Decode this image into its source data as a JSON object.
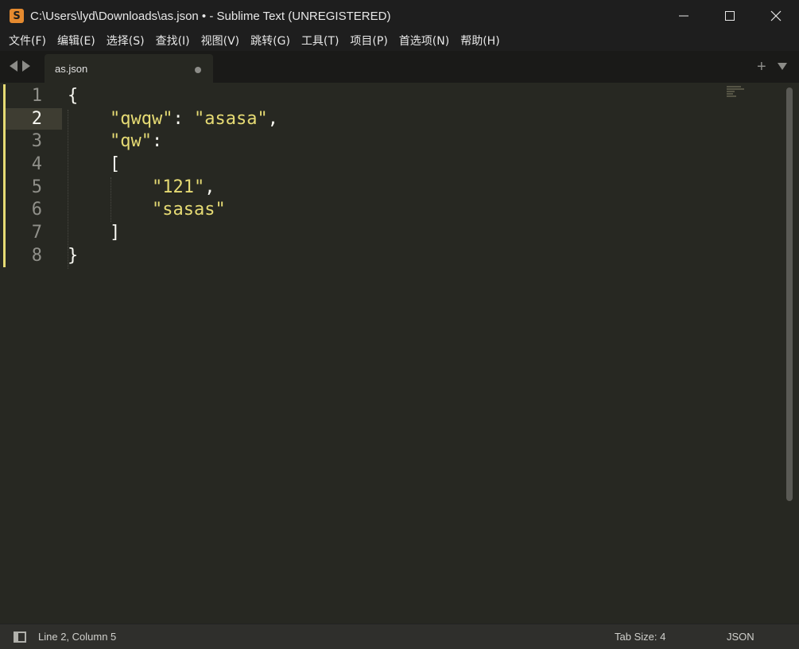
{
  "window": {
    "title": "C:\\Users\\lyd\\Downloads\\as.json • - Sublime Text (UNREGISTERED)",
    "app_icon": "sublime-text-icon",
    "controls": [
      "minimize-icon",
      "maximize-icon",
      "close-icon"
    ]
  },
  "menu": {
    "items": [
      "文件(F)",
      "编辑(E)",
      "选择(S)",
      "查找(I)",
      "视图(V)",
      "跳转(G)",
      "工具(T)",
      "项目(P)",
      "首选项(N)",
      "帮助(H)"
    ]
  },
  "tabs": {
    "active": {
      "label": "as.json",
      "dirty": true
    },
    "nav_icons": [
      "arrow-left-icon",
      "arrow-right-icon"
    ],
    "new_tab_icon": "plus-icon",
    "menu_icon": "chevron-down-icon"
  },
  "editor": {
    "current_line": 2,
    "line_numbers": [
      "1",
      "2",
      "3",
      "4",
      "5",
      "6",
      "7",
      "8"
    ],
    "lines": [
      [
        {
          "t": "{",
          "c": "punct"
        }
      ],
      [
        {
          "t": "    ",
          "c": "ws"
        },
        {
          "t": "\"qwqw\"",
          "c": "str"
        },
        {
          "t": ": ",
          "c": "punct"
        },
        {
          "t": "\"asasa\"",
          "c": "str"
        },
        {
          "t": ",",
          "c": "punct"
        }
      ],
      [
        {
          "t": "    ",
          "c": "ws"
        },
        {
          "t": "\"qw\"",
          "c": "str"
        },
        {
          "t": ":",
          "c": "punct"
        }
      ],
      [
        {
          "t": "    ",
          "c": "ws"
        },
        {
          "t": "[",
          "c": "punct"
        }
      ],
      [
        {
          "t": "        ",
          "c": "ws"
        },
        {
          "t": "\"121\"",
          "c": "str"
        },
        {
          "t": ",",
          "c": "punct"
        }
      ],
      [
        {
          "t": "        ",
          "c": "ws"
        },
        {
          "t": "\"sasas\"",
          "c": "str"
        }
      ],
      [
        {
          "t": "    ",
          "c": "ws"
        },
        {
          "t": "]",
          "c": "punct"
        }
      ],
      [
        {
          "t": "}",
          "c": "punct"
        }
      ]
    ]
  },
  "status": {
    "position": "Line 2, Column 5",
    "tab_size": "Tab Size: 4",
    "syntax": "JSON",
    "panel_icon": "panel-toggle-icon"
  },
  "colors": {
    "editor_bg": "#272822",
    "string": "#e6db74",
    "text": "#f8f8f2",
    "gutter_text": "#90908a"
  }
}
